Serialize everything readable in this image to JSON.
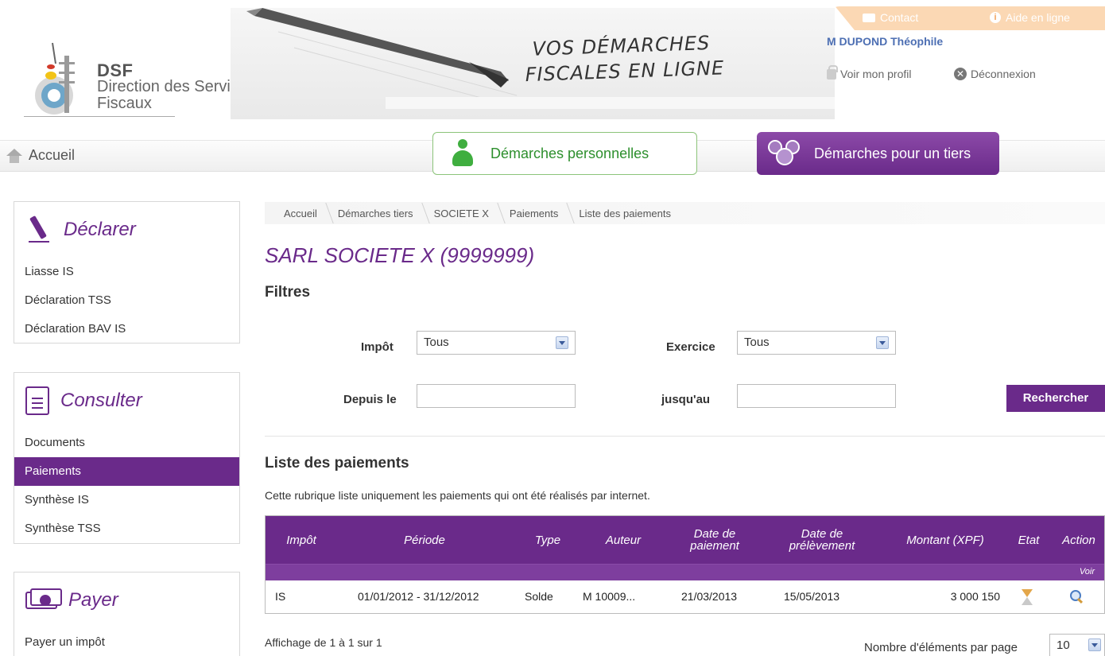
{
  "logo": {
    "brand": "DSF",
    "line1": "Direction des Services",
    "line2": "Fiscaux"
  },
  "banner": {
    "slogan_line1": "VOS DÉMARCHES",
    "slogan_line2": "FISCALES EN LIGNE"
  },
  "top_links": {
    "contact": "Contact",
    "help": "Aide en ligne"
  },
  "user": {
    "name": "M DUPOND Théophile",
    "profile_link": "Voir mon profil",
    "logout_link": "Déconnexion"
  },
  "nav": {
    "home": "Accueil",
    "tab_personal": "Démarches personnelles",
    "tab_third_party": "Démarches pour un tiers"
  },
  "sidebar": {
    "declarer": {
      "title": "Déclarer",
      "items": [
        "Liasse IS",
        "Déclaration TSS",
        "Déclaration BAV IS"
      ]
    },
    "consulter": {
      "title": "Consulter",
      "items": [
        "Documents",
        "Paiements",
        "Synthèse IS",
        "Synthèse TSS"
      ],
      "active": "Paiements"
    },
    "payer": {
      "title": "Payer",
      "items": [
        "Payer un impôt"
      ]
    }
  },
  "breadcrumb": [
    "Accueil",
    "Démarches tiers",
    "SOCIETE X",
    "Paiements",
    "Liste des paiements"
  ],
  "company_title": "SARL SOCIETE X (9999999)",
  "filters": {
    "heading": "Filtres",
    "impot_label": "Impôt",
    "impot_value": "Tous",
    "exercice_label": "Exercice",
    "exercice_value": "Tous",
    "depuis_label": "Depuis le",
    "depuis_value": "",
    "jusqu_label": "jusqu'au",
    "jusqu_value": "",
    "search_button": "Rechercher"
  },
  "list": {
    "heading": "Liste des paiements",
    "description": "Cette rubrique liste uniquement les paiements qui ont été réalisés par internet.",
    "columns": {
      "impot": "Impôt",
      "periode": "Période",
      "type": "Type",
      "auteur": "Auteur",
      "date_paiement_1": "Date de",
      "date_paiement_2": "paiement",
      "date_prelevement_1": "Date de",
      "date_prelevement_2": "prélèvement",
      "montant": "Montant (XPF)",
      "etat": "Etat",
      "action": "Action",
      "action_sub": "Voir"
    },
    "rows": [
      {
        "impot": "IS",
        "periode": "01/01/2012 - 31/12/2012",
        "type": "Solde",
        "auteur": "M 10009...",
        "date_paiement": "21/03/2013",
        "date_prelevement": "15/05/2013",
        "montant": "3 000 150",
        "etat_icon": "hourglass-icon",
        "action_icon": "magnifier-icon"
      }
    ],
    "pagination_text": "Affichage de 1 à 1 sur 1",
    "page_size_label": "Nombre d'éléments par page",
    "page_size_value": "10"
  },
  "colors": {
    "accent": "#6a2a8a",
    "green": "#3fae3f",
    "contact_bar": "#fbd8b4",
    "user_blue": "#4d6fb3"
  }
}
